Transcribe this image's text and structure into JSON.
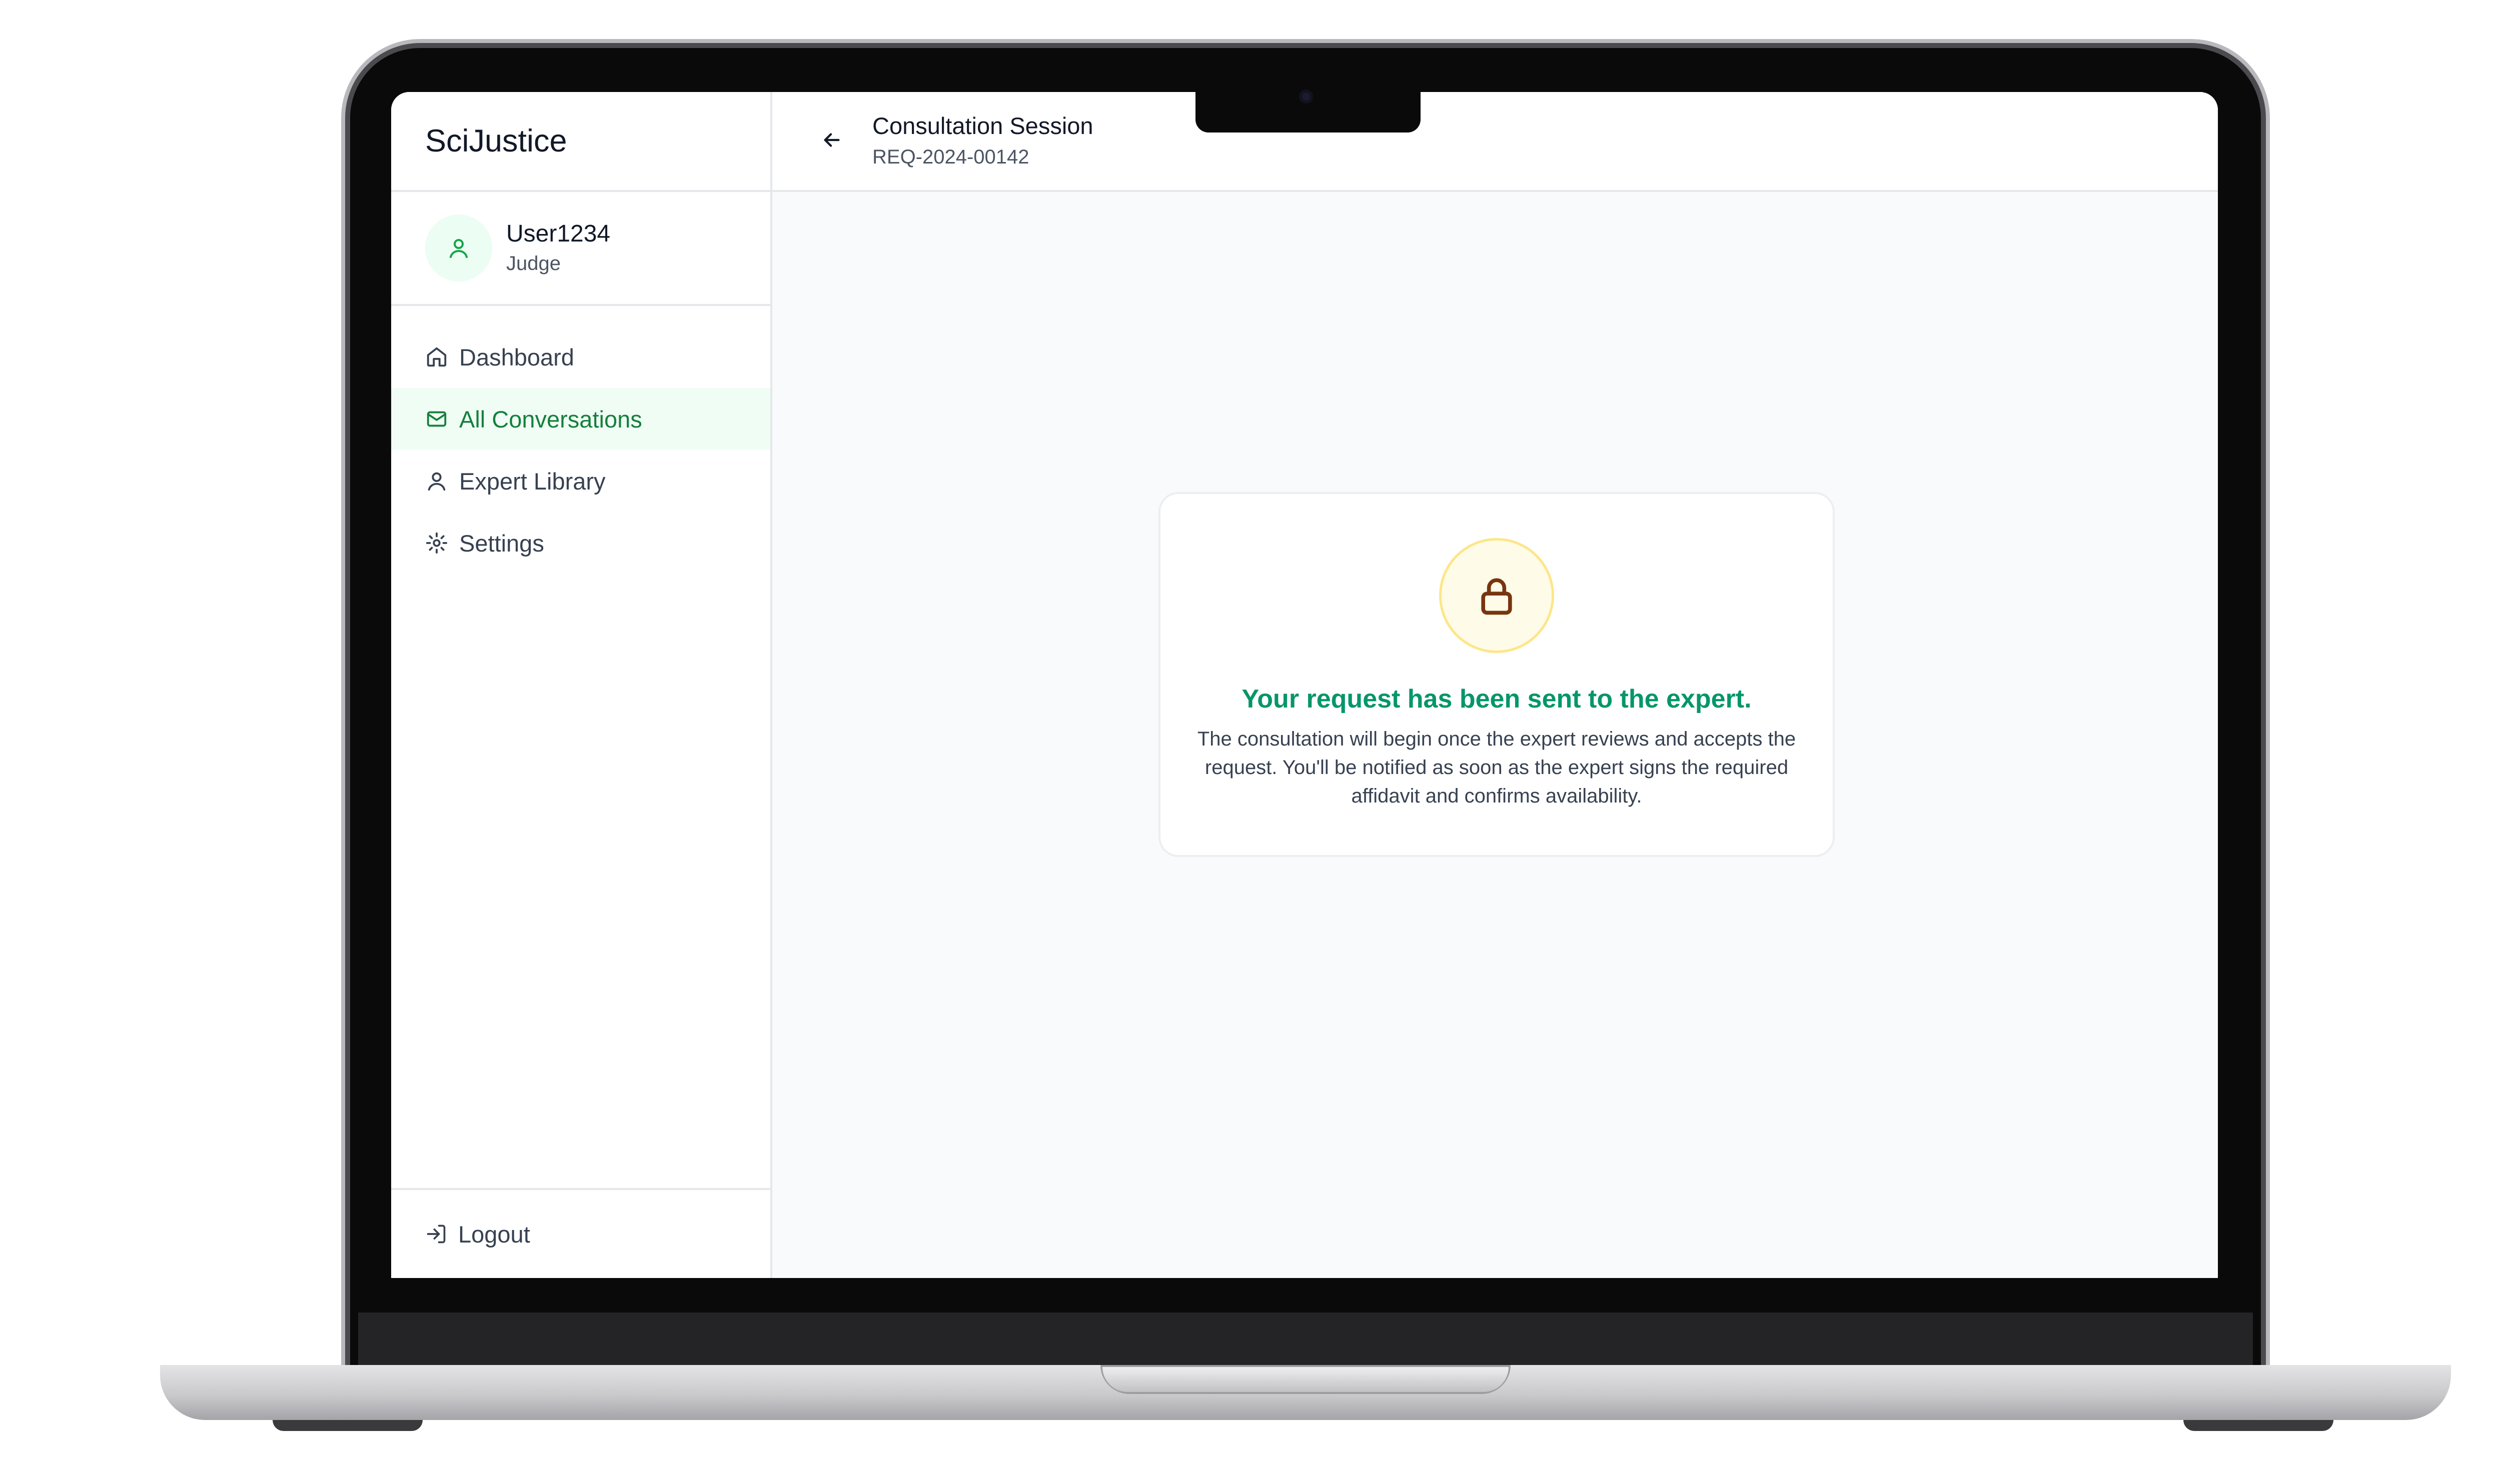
{
  "app": {
    "name": "SciJustice"
  },
  "user": {
    "name": "User1234",
    "role": "Judge"
  },
  "nav": {
    "items": [
      {
        "label": "Dashboard",
        "icon": "home-icon"
      },
      {
        "label": "All Conversations",
        "icon": "mail-icon",
        "active": true
      },
      {
        "label": "Expert Library",
        "icon": "user-icon"
      },
      {
        "label": "Settings",
        "icon": "gear-icon"
      }
    ],
    "logout_label": "Logout"
  },
  "header": {
    "title": "Consultation Session",
    "request_id": "REQ-2024-00142"
  },
  "status_card": {
    "icon": "lock-icon",
    "title": "Your request has been sent to the expert.",
    "body": "The consultation will begin once the expert reviews and accepts the request. You'll be notified as soon as the expert signs the required affidavit and confirms availability."
  },
  "colors": {
    "accent": "#059669",
    "active_bg": "#f0fdf4",
    "lock_bg": "#fefce8",
    "lock_icon": "#78350f"
  }
}
